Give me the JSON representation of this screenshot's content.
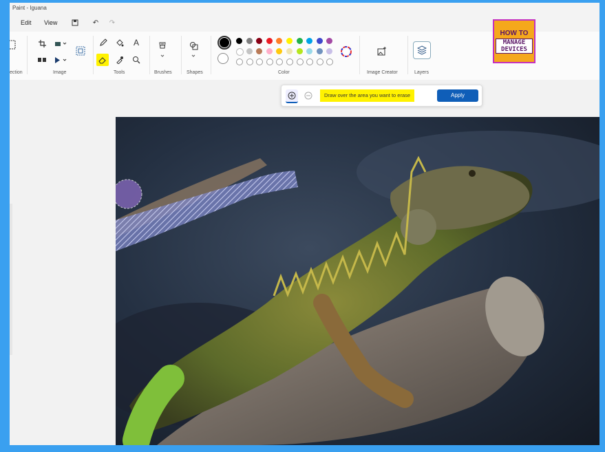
{
  "window": {
    "title": "Paint - Iguana"
  },
  "menu": {
    "edit": "Edit",
    "view": "View"
  },
  "ribbon": {
    "groups": {
      "selection": "ection",
      "image": "Image",
      "tools": "Tools",
      "brushes": "Brushes",
      "shapes": "Shapes",
      "color": "Color",
      "image_creator": "Image Creator",
      "layers": "Layers"
    }
  },
  "colors": {
    "row1": [
      "#000000",
      "#7f7f7f",
      "#880015",
      "#ed1c24",
      "#ff7f27",
      "#fff200",
      "#22b14c",
      "#00a2e8",
      "#3f48cc",
      "#a349a4"
    ],
    "row2": [
      "#ffffff",
      "#c3c3c3",
      "#b97a57",
      "#ffaec9",
      "#ffc90e",
      "#efe4b0",
      "#b5e61d",
      "#99d9ea",
      "#7092be",
      "#c8bfe7"
    ],
    "primary": "#000000",
    "secondary": "#ffffff",
    "highlight": "#fff200",
    "accent": "#0f5eb8"
  },
  "logo": {
    "top": "HOW TO",
    "line1": "MANAGE",
    "line2": "DEVICES"
  },
  "erase_bar": {
    "hint": "Draw over the area you want to erase",
    "apply": "Apply"
  }
}
